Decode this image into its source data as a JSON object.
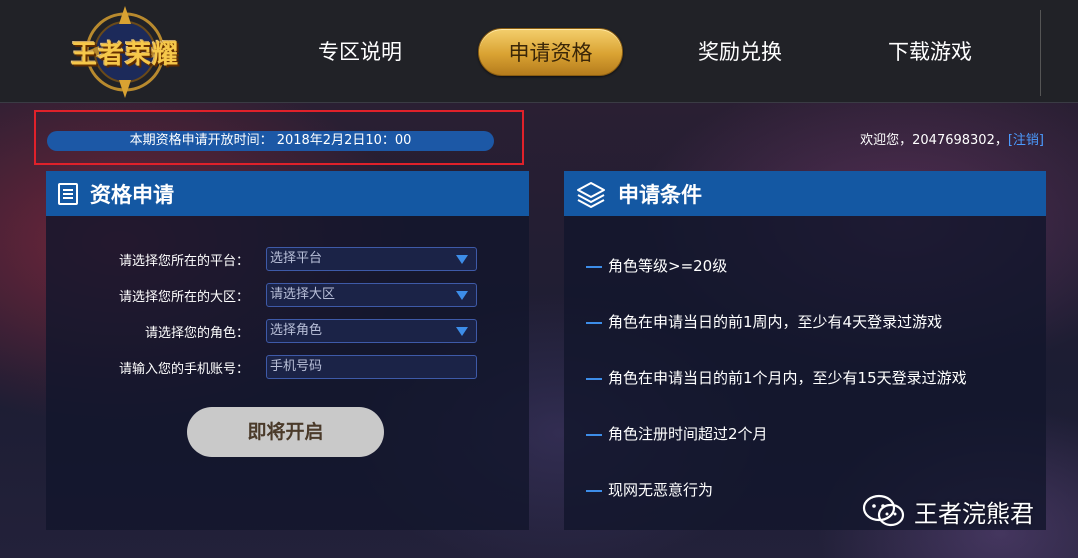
{
  "header": {
    "logo_text": "王者荣耀",
    "nav": [
      "专区说明",
      "申请资格",
      "奖励兑换",
      "下载游戏"
    ]
  },
  "notice": {
    "open_time": "本期资格申请开放时间： 2018年2月2日10：00"
  },
  "user": {
    "welcome": "欢迎您，2047698302，",
    "logout": "[注销]"
  },
  "apply_panel": {
    "title": "资格申请",
    "fields": [
      {
        "label": "请选择您所在的平台：",
        "value": "选择平台"
      },
      {
        "label": "请选择您所在的大区：",
        "value": "请选择大区"
      },
      {
        "label": "请选择您的角色：",
        "value": "选择角色"
      },
      {
        "label": "请输入您的手机账号：",
        "placeholder": "手机号码"
      }
    ],
    "submit": "即将开启"
  },
  "conditions_panel": {
    "title": "申请条件",
    "items": [
      "角色等级>=20级",
      "角色在申请当日的前1周内，至少有4天登录过游戏",
      "角色在申请当日的前1个月内，至少有15天登录过游戏",
      "角色注册时间超过2个月",
      "现网无恶意行为"
    ]
  },
  "watermark": {
    "text": "王者浣熊君"
  },
  "colors": {
    "header_bg": "#212227",
    "panel_head": "#1458a3",
    "accent_gold": "#d9a232",
    "accent_blue": "#3d8de8",
    "highlight_red": "#e0212a"
  }
}
